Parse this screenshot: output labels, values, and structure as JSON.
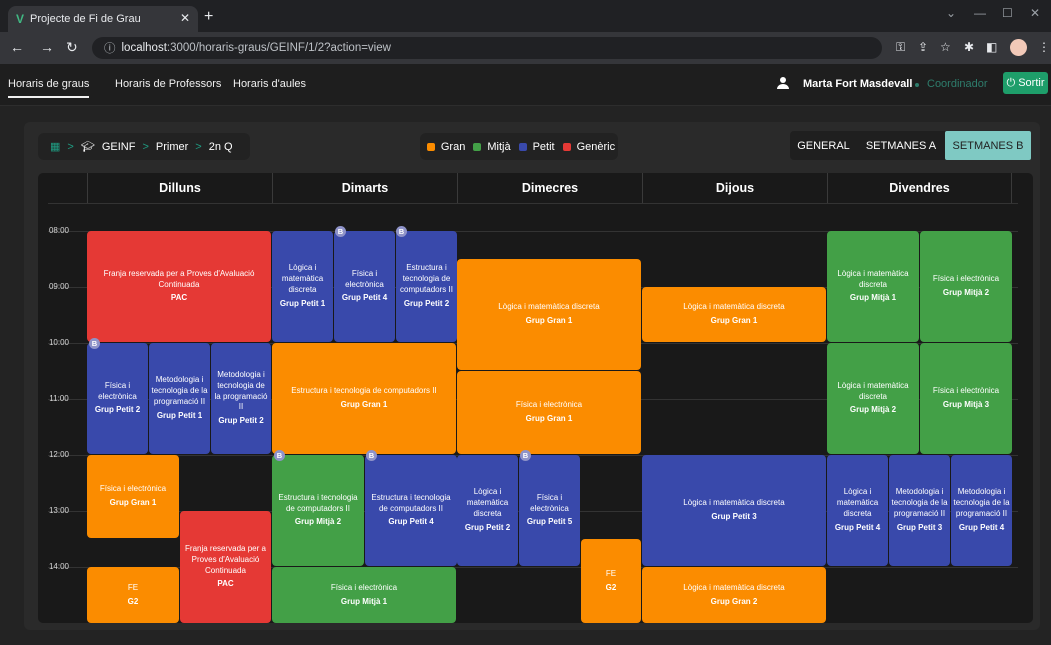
{
  "browser": {
    "tab_title": "Projecte de Fi de Grau",
    "url_host": "localhost",
    "url_rest": ":3000/horaris-graus/GEINF/1/2?action=view"
  },
  "nav": {
    "links": [
      "Horaris de graus",
      "Horaris de Professors",
      "Horaris d'aules"
    ],
    "user": "Marta Fort Masdevall",
    "role": "Coordinador",
    "logout": "Sortir"
  },
  "breadcrumb": [
    "GEINF",
    "Primer",
    "2n Q"
  ],
  "legend": [
    {
      "label": "Gran",
      "color": "#fb8c00"
    },
    {
      "label": "Mitjà",
      "color": "#43a047"
    },
    {
      "label": "Petit",
      "color": "#3949ab"
    },
    {
      "label": "Genèric",
      "color": "#e53935"
    }
  ],
  "view_tabs": [
    "GENERAL",
    "SETMANES A",
    "SETMANES B"
  ],
  "days": [
    "Dilluns",
    "Dimarts",
    "Dimecres",
    "Dijous",
    "Divendres"
  ],
  "times": [
    "08:00",
    "09:00",
    "10:00",
    "11:00",
    "12:00",
    "13:00",
    "14:00"
  ],
  "week_badge": "B",
  "events": {
    "e1": {
      "title": "Franja reservada per a Proves d'Avaluació Continuada",
      "group": "PAC"
    },
    "e2": {
      "title": "Lògica i matemàtica discreta",
      "group": "Grup Petit 1"
    },
    "e3": {
      "title": "Física i electrònica",
      "group": "Grup Petit 4"
    },
    "e4": {
      "title": "Estructura i tecnologia de computadors II",
      "group": "Grup Petit 2"
    },
    "e5": {
      "title": "Lògica i matemàtica discreta",
      "group": "Grup Gran 1"
    },
    "e6": {
      "title": "Lògica i matemàtica discreta",
      "group": "Grup Gran 1"
    },
    "e7": {
      "title": "Lògica i matemàtica discreta",
      "group": "Grup Mitjà 1"
    },
    "e8": {
      "title": "Física i electrònica",
      "group": "Grup Mitjà 2"
    },
    "e9": {
      "title": "Física i electrònica",
      "group": "Grup Petit 2"
    },
    "e10": {
      "title": "Metodologia i tecnologia de la programació II",
      "group": "Grup Petit 1"
    },
    "e11": {
      "title": "Metodologia i tecnologia de la programació II",
      "group": "Grup Petit 2"
    },
    "e12": {
      "title": "Estructura i tecnologia de computadors II",
      "group": "Grup Gran 1"
    },
    "e13": {
      "title": "Física i electrònica",
      "group": "Grup Gran 1"
    },
    "e14": {
      "title": "Lògica i matemàtica discreta",
      "group": "Grup Mitjà 2"
    },
    "e15": {
      "title": "Física i electrònica",
      "group": "Grup Mitjà 3"
    },
    "e16": {
      "title": "Física i electrònica",
      "group": "Grup Gran 1"
    },
    "e17": {
      "title": "Franja reservada per a Proves d'Avaluació Continuada",
      "group": "PAC"
    },
    "e18": {
      "title": "Estructura i tecnologia de computadors II",
      "group": "Grup Mitjà 2"
    },
    "e19": {
      "title": "Estructura i tecnologia de computadors II",
      "group": "Grup Petit 4"
    },
    "e20": {
      "title": "Lògica i matemàtica discreta",
      "group": "Grup Petit 2"
    },
    "e21": {
      "title": "Física i electrònica",
      "group": "Grup Petit 5"
    },
    "e22": {
      "title": "Lògica i matemàtica discreta",
      "group": "Grup Petit 3"
    },
    "e23": {
      "title": "Lògica i matemàtica discreta",
      "group": "Grup Petit 4"
    },
    "e24": {
      "title": "Metodologia i tecnologia de la programació II",
      "group": "Grup Petit 3"
    },
    "e25": {
      "title": "Metodologia i tecnologia de la programació II",
      "group": "Grup Petit 4"
    },
    "e26": {
      "title": "FE",
      "group": "G2"
    },
    "e27": {
      "title": "FE",
      "group": "G2"
    },
    "e28": {
      "title": "Física i electrònica",
      "group": "Grup Mitjà 1"
    },
    "e29": {
      "title": "Lògica i matemàtica discreta",
      "group": "Grup Gran 2"
    }
  }
}
